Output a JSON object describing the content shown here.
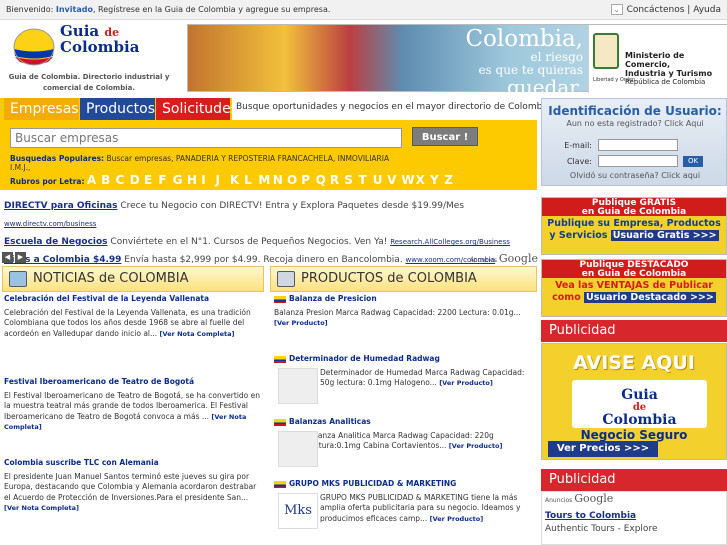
{
  "topbar": {
    "greeting": "Bienvenido:",
    "user": "Invitado",
    "msg": ", Regístrese en la Guia de Colombia y agregue su empresa.",
    "right": "Concáctenos | Ayuda"
  },
  "logo": {
    "line1": "Guia",
    "line2": "de",
    "line3": "Colombia",
    "tagline1": "Guia de Colombia. Directorio industrial y",
    "tagline2": "comercial de Colombia."
  },
  "banner": {
    "t1": "Colombia,",
    "t2": "el riesgo",
    "t3": "es que te quieras",
    "t4": "quedar.",
    "m1": "Ministerio de Comercio,",
    "m2": "Industria y Turismo",
    "m3": "República de Colombia",
    "small": "Libertad y Orden"
  },
  "search": {
    "tabs": [
      "Empresas",
      "Productos",
      "Solicitudes"
    ],
    "desc": "Busque oportunidades y negocios en el mayor directorio de Colombia",
    "placeholder": "Buscar empresas",
    "button": "Buscar !",
    "popular_label": "Busquedas Populares:",
    "popular_items": "Buscar empresas, PANADERIA Y REPOSTERIA FRANCACHELA, INMOVILIARIA I.M.J.,",
    "letters_label": "Rubros por Letra:",
    "letters": [
      "A",
      "B",
      "C",
      "D",
      "E",
      "F",
      "G",
      "H",
      "I",
      "J",
      "K",
      "L",
      "M",
      "N",
      "O",
      "P",
      "Q",
      "R",
      "S",
      "T",
      "U",
      "V",
      "W",
      "X",
      "Y",
      "Z"
    ]
  },
  "login": {
    "title": "Identificación de Usuario:",
    "sub": "Aun no esta registrado? Click Aqui",
    "email": "E-mail:",
    "pass": "Clave:",
    "ok": "OK",
    "forgot": "Olvidó su contraseña? Click aqui"
  },
  "ads": [
    {
      "b": "DIRECTV para Oficinas",
      "t": " Crece tu Negocio con DIRECTV! Entra y Explora Paquetes desde $19.99/Mes ",
      "u": "www.directv.com/business"
    },
    {
      "b": "Escuela de Negocios",
      "t": " Conviértete en el N°1. Cursos de Pequeños Negocios. Ven Ya! ",
      "u": "Research.AllColleges.org/Business"
    },
    {
      "b": "Giros a Colombia $4.99",
      "t": " Envía hasta $2,999 por $4.99. Recoja dinero en Bancolombia. ",
      "u": "www.xoom.com/colombia"
    }
  ],
  "adsby": {
    "label": "Anuncios",
    "brand": "Google"
  },
  "noticias": {
    "title": "NOTICIAS de COLOMBIA",
    "items": [
      {
        "title": "Celebración del Festival de la Leyenda Vallenata",
        "body": "Celebración del Festival de la Leyenda Vallenata, es una tradición Colombiana que todos los años desde 1968 se abre al fuelle del acordeón en Valledupar dando inicio al...",
        "more": "[Ver Nota Completa]"
      },
      {
        "title": "Festival Iberoamericano de Teatro de Bogotá",
        "body": "El Festival Iberoamericano de Teatro de Bogotá, se ha convertido en la muestra teatral más grande de todos Iberoamerica. El Festival Iberoamericano de Teatro de Bogotá convoca a más ... ",
        "more": "[Ver Nota Completa]"
      },
      {
        "title": "Colombia suscribe TLC con Alemania",
        "body": "El presidente Juan Manuel Santos terminó este jueves su gira por Europa, destacando que Colombia y Alemania acordaron destrabar el Acuerdo de Protección de Inversiones.Para el presidente  San... ",
        "more": "[Ver Nota Completa]"
      }
    ]
  },
  "productos": {
    "title": "PRODUCTOS de COLOMBIA",
    "items": [
      {
        "title": "Balanza de Presicion",
        "body": "Balanza Presion Marca Radwag Capacidad: 2200 Lectura: 0.01g...",
        "more": "[Ver Producto]"
      },
      {
        "title": "Determinador de Humedad Radwag",
        "body": "Determinador de Humedad Marca Radwag Capacidad: 50g lectura: 0.1mg Halogeno... ",
        "more": "[Ver Producto]"
      },
      {
        "title": "Balanzas Analiticas",
        "body": "Balanza Analitica Marca Radwag Capacidad: 220g Lectura:0.1mg Cabina Cortavientos... ",
        "more": "[Ver Producto]"
      },
      {
        "title": "GRUPO MKS PUBLICIDAD & MARKETING",
        "body": "GRUPO MKS PUBLICIDAD & MARKETING tiene la más amplia oferta publicitaria para su negocio. Ideamos y producimos eficaces camp... ",
        "more": "[Ver Producto]",
        "logo": "Mks"
      }
    ]
  },
  "right": {
    "p1h1": "Publique GRATIS",
    "p1h2": "en Guia de Colombia",
    "p1b1": "Publique su Empresa, Productos",
    "p1b2": "y Servicios",
    "p1btn": "Usuario Gratis >>>",
    "p2h1": "Publique DESTACADO",
    "p2h2": "en Guia de Colombia",
    "p2b1": "Vea las VENTAJAS de Publicar",
    "p2b2": "como",
    "p2btn": "Usuario Destacado >>>",
    "pub1": "Publicidad",
    "avise": "AVISE AQUI",
    "av_logo1": "Guia",
    "av_logo2": "de",
    "av_logo3": "Colombia",
    "negocio": "Negocio Seguro",
    "precios": "Ver Precios >>>",
    "pub2": "Publicidad",
    "ad_label": "Anuncios",
    "ad_brand": "Google",
    "ad_title": "Tours to Colombia",
    "ad_text": "Authentic Tours - Explore"
  }
}
